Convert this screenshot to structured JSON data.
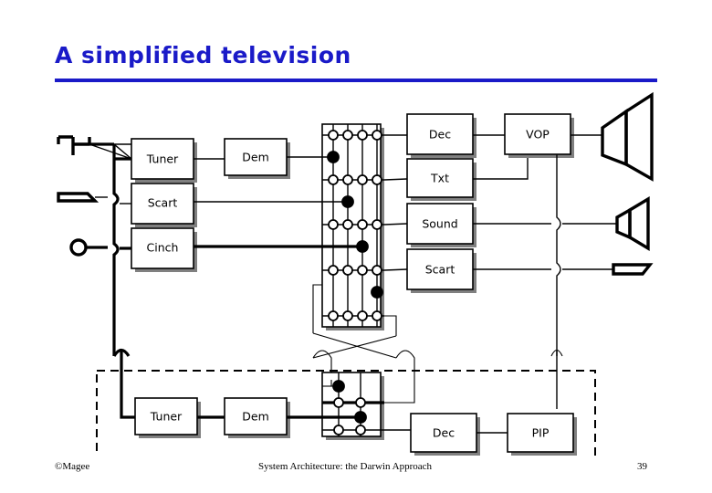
{
  "slide": {
    "title": "A simplified television",
    "title_color": "#1a1ac8",
    "page_number": "39",
    "footer_left": "©Magee",
    "footer_center": "System Architecture: the Darwin Approach"
  },
  "diagram": {
    "type": "block-diagram",
    "description": "Simplified television block diagram with input connectors, tuner/demodulator chains, a crossbar switch matrix, output decoders and a picture-in-picture subsystem.",
    "inputs": [
      {
        "id": "antenna",
        "icon": "antenna-icon",
        "label": ""
      },
      {
        "id": "scart-in",
        "icon": "scart-connector-icon",
        "label": ""
      },
      {
        "id": "cinch-in",
        "icon": "cinch-connector-icon",
        "label": ""
      }
    ],
    "outputs": [
      {
        "id": "crt-display",
        "icon": "crt-display-icon",
        "label": ""
      },
      {
        "id": "speaker",
        "icon": "speaker-icon",
        "label": ""
      },
      {
        "id": "scart-out",
        "icon": "scart-connector-icon",
        "label": ""
      }
    ],
    "main_blocks": [
      {
        "id": "tuner-main",
        "label": "Tuner"
      },
      {
        "id": "dem-main",
        "label": "Dem"
      },
      {
        "id": "scart-main",
        "label": "Scart"
      },
      {
        "id": "cinch-main",
        "label": "Cinch"
      },
      {
        "id": "dec-main",
        "label": "Dec"
      },
      {
        "id": "txt-main",
        "label": "Txt"
      },
      {
        "id": "sound-main",
        "label": "Sound"
      },
      {
        "id": "scart-out-block",
        "label": "Scart"
      },
      {
        "id": "vop",
        "label": "VOP"
      }
    ],
    "pip_blocks": [
      {
        "id": "tuner-pip",
        "label": "Tuner"
      },
      {
        "id": "dem-pip",
        "label": "Dem"
      },
      {
        "id": "dec-pip",
        "label": "Dec"
      },
      {
        "id": "pip",
        "label": "PIP"
      }
    ],
    "main_crossbar": {
      "id": "main-crossbar",
      "columns": 4,
      "rows": 5,
      "closed_connections": [
        {
          "row": 0,
          "column": 0
        },
        {
          "row": 1,
          "column": 1
        },
        {
          "row": 2,
          "column": 2
        },
        {
          "row": 3,
          "column": 3
        }
      ]
    },
    "pip_crossbar": {
      "id": "pip-crossbar",
      "columns": 2,
      "rows": 3,
      "closed_connections": [
        {
          "row": 0,
          "column": 0
        },
        {
          "row": 1,
          "column": 1
        }
      ]
    },
    "pip_region": {
      "id": "pip-subsystem",
      "border_style": "dashed"
    },
    "colors": {
      "line": "#000000",
      "box_fill": "#ffffff",
      "box_stroke": "#000000",
      "box_shadow": "#808080",
      "background": "#ffffff"
    }
  }
}
